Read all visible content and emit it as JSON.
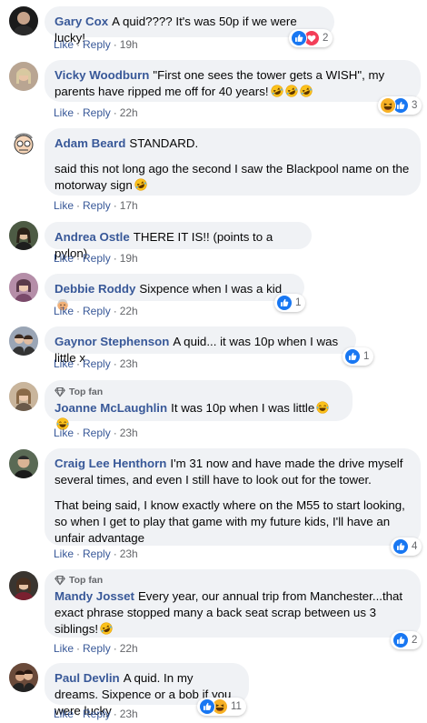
{
  "like_label": "Like",
  "reply_label": "Reply",
  "top_fan_label": "Top fan",
  "colors": {
    "name": "#385898",
    "bubble": "#f0f2f5",
    "meta": "#65676b",
    "like_blue": "#1877f2"
  },
  "comments": [
    {
      "author": "Gary Cox",
      "text": "A quid???? It's was 50p if we were lucky!",
      "time": "19h",
      "reactions": [
        "like-icon",
        "love-icon"
      ],
      "reaction_count": "2"
    },
    {
      "author": "Vicky Woodburn",
      "text": "\"First one sees the tower gets a WISH\", my parents have ripped me off for 40 years!",
      "emoji": [
        "rofl-emoji",
        "rofl-emoji",
        "rofl-emoji"
      ],
      "time": "22h",
      "reactions": [
        "haha-icon",
        "like-icon"
      ],
      "reaction_count": "3"
    },
    {
      "author": "Adam Beard",
      "text": "STANDARD.",
      "text2": "said this not long ago the second I saw the Blackpool name on the motorway sign",
      "emoji2": [
        "rofl-emoji"
      ],
      "time": "17h"
    },
    {
      "author": "Andrea Ostle",
      "text": "THERE IT IS!! (points to a pylon)",
      "time": "19h"
    },
    {
      "author": "Debbie Roddy",
      "text": "Sixpence when I was a kid",
      "emoji": [
        "old-woman-emoji"
      ],
      "time": "22h",
      "reactions": [
        "like-icon"
      ],
      "reaction_count": "1"
    },
    {
      "author": "Gaynor Stephenson",
      "text": "A quid... it was 10p when I was little x",
      "time": "23h",
      "reactions": [
        "like-icon"
      ],
      "reaction_count": "1"
    },
    {
      "author": "Joanne McLaughlin",
      "top_fan": true,
      "text": "It was 10p when I was little",
      "emoji": [
        "joy-emoji",
        "joy-emoji"
      ],
      "time": "23h"
    },
    {
      "author": "Craig Lee Henthorn",
      "text": "I'm 31 now and have made the drive myself several times, and even I still have to look out for the tower.",
      "text2": "That being said, I know exactly where on the M55 to start looking, so when I get to play that game with my future kids, I'll have an unfair advantage",
      "time": "23h",
      "reactions": [
        "like-icon"
      ],
      "reaction_count": "4"
    },
    {
      "author": "Mandy Josset",
      "top_fan": true,
      "text": "Every year, our annual trip from Manchester...that exact phrase stopped many a back seat scrap between us 3 siblings!",
      "emoji": [
        "rofl-emoji"
      ],
      "time": "22h",
      "reactions": [
        "like-icon"
      ],
      "reaction_count": "2"
    },
    {
      "author": "Paul Devlin",
      "text": "A quid. In my dreams. Sixpence or a bob if you were lucky",
      "time": "23h",
      "reactions": [
        "like-icon",
        "haha-icon"
      ],
      "reaction_count": "11"
    }
  ]
}
